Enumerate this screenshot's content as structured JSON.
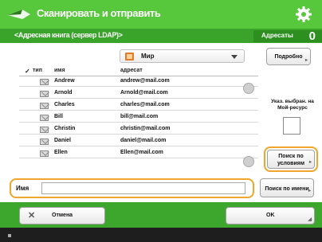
{
  "title_bar": {
    "title": "Сканировать и отправить"
  },
  "sub_bar": {
    "breadcrumb": "<Адресная книга (сервер LDAP)>",
    "count_label": "Адресаты",
    "count_value": "0"
  },
  "dropdown": {
    "selected": "Мир"
  },
  "list_header": {
    "col_type": "тип",
    "col_name": "имя",
    "col_address": "адресат"
  },
  "entries": [
    {
      "name": "Andrew",
      "address": "andrew@mail.com"
    },
    {
      "name": "Arnold",
      "address": "Arnold@mail.com"
    },
    {
      "name": "Charles",
      "address": "charles@mail.com"
    },
    {
      "name": "Bill",
      "address": "bill@mail.com"
    },
    {
      "name": "Christin",
      "address": "christin@mail.com"
    },
    {
      "name": "Daniel",
      "address": "daniel@mail.com"
    },
    {
      "name": "Ellen",
      "address": "Ellen@mail.com"
    }
  ],
  "buttons": {
    "details": "Подробно",
    "set_search": "Поиск по условиям",
    "search_name": "Поиск по имени",
    "cancel": "Отмена",
    "ok": "OK"
  },
  "side_panel": {
    "label": "Указ. выбран. на Мой-ресурс"
  },
  "filter": {
    "label": "Имя",
    "value": ""
  },
  "colors": {
    "title_green": "#57c73c",
    "sub_green": "#39a32a",
    "bottom_green": "#3da62c",
    "highlight": "#f0a52c"
  },
  "icons": {
    "title": "scan-send-arrow-icon",
    "settings": "gear-icon",
    "dropdown": "address-book-icon",
    "entry": "email-icon"
  }
}
